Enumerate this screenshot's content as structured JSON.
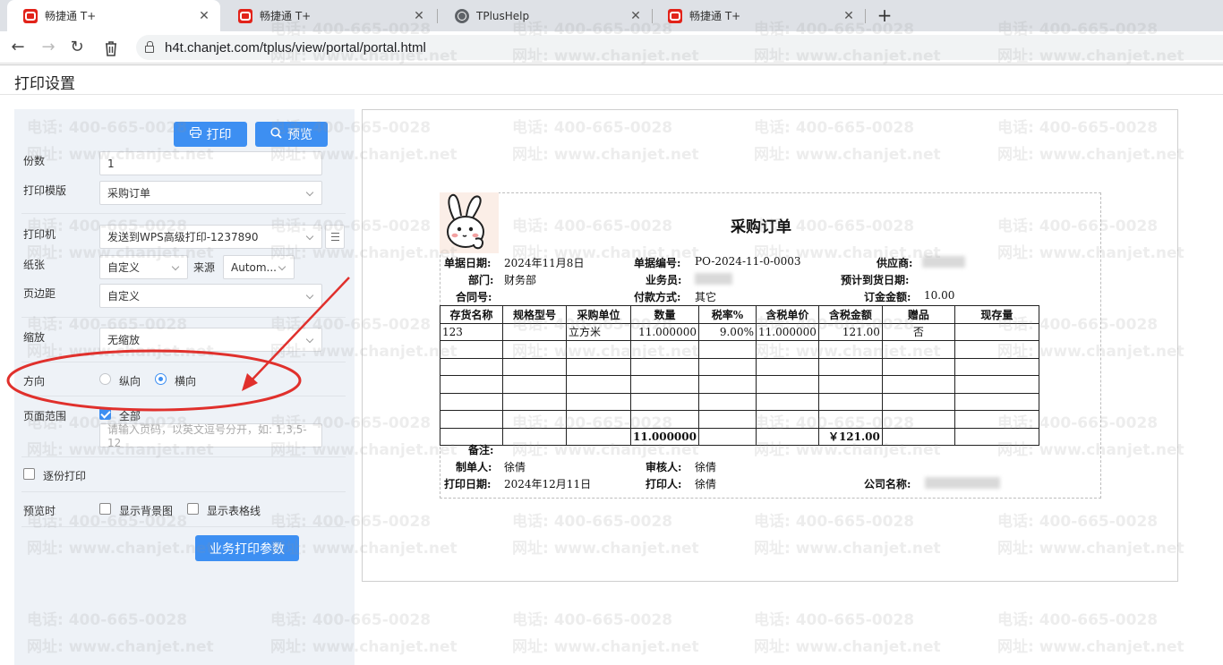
{
  "browser": {
    "tabs": [
      {
        "label": "畅捷通 T+",
        "icon": "chanjet-icon",
        "active": true
      },
      {
        "label": "畅捷通 T+",
        "icon": "chanjet-icon",
        "active": false
      },
      {
        "label": "TPlusHelp",
        "icon": "globe-icon",
        "active": false
      },
      {
        "label": "畅捷通 T+",
        "icon": "chanjet-icon",
        "active": false
      }
    ],
    "url": "h4t.chanjet.com/tplus/view/portal/portal.html"
  },
  "page": {
    "title": "打印设置"
  },
  "settings": {
    "print_button": "打印",
    "preview_button": "预览",
    "copies_label": "份数",
    "copies_value": "1",
    "template_label": "打印模版",
    "template_value": "采购订单",
    "printer_label": "打印机",
    "printer_value": "发送到WPS高级打印-1237890",
    "paper_label": "纸张",
    "paper_value": "自定义",
    "source_label": "来源",
    "source_value": "Autom...",
    "margin_label": "页边距",
    "margin_value": "自定义",
    "zoom_label": "缩放",
    "zoom_value": "无缩放",
    "orientation_label": "方向",
    "portrait_label": "纵向",
    "landscape_label": "横向",
    "orientation_selected": "横向",
    "range_label": "页面范围",
    "all_label": "全部",
    "all_checked": true,
    "range_placeholder": "请输入页码，以英文逗号分开，如: 1,3,5-12",
    "collate_label": "逐份打印",
    "collate_checked": false,
    "preview_label": "预览时",
    "show_bg_label": "显示背景图",
    "show_bg_checked": false,
    "show_grid_label": "显示表格线",
    "show_grid_checked": false,
    "biz_params_button": "业务打印参数"
  },
  "document": {
    "title": "采购订单",
    "fields": {
      "date_label": "单据日期:",
      "date_value": "2024年11月8日",
      "number_label": "单据编号:",
      "number_value": "PO-2024-11-0-0003",
      "supplier_label": "供应商:",
      "dept_label": "部门:",
      "dept_value": "财务部",
      "clerk_label": "业务员:",
      "arrival_label": "预计到货日期:",
      "contract_label": "合同号:",
      "payment_label": "付款方式:",
      "payment_value": "其它",
      "deposit_label": "订金金额:",
      "deposit_value": "10.00",
      "remark_label": "备注:",
      "maker_label": "制单人:",
      "maker_value": "徐倩",
      "reviewer_label": "审核人:",
      "reviewer_value": "徐倩",
      "print_date_label": "打印日期:",
      "print_date_value": "2024年12月11日",
      "printer_label": "打印人:",
      "printer_value": "徐倩",
      "company_label": "公司名称:"
    },
    "table": {
      "headers": [
        "存货名称",
        "规格型号",
        "采购单位",
        "数量",
        "税率%",
        "含税单价",
        "含税金额",
        "赠品",
        "现存量"
      ],
      "rows": [
        [
          "123",
          "",
          "立方米",
          "11.000000",
          "9.00%",
          "11.000000",
          "121.00",
          "否",
          ""
        ]
      ],
      "total_qty": "11.000000",
      "total_amount": "￥121.00"
    }
  },
  "watermark": {
    "phone": "电话: 400-665-0028",
    "site": "网址: www.chanjet.net"
  },
  "annotation_color": "#e0302c",
  "accent_color": "#3d8ff2"
}
